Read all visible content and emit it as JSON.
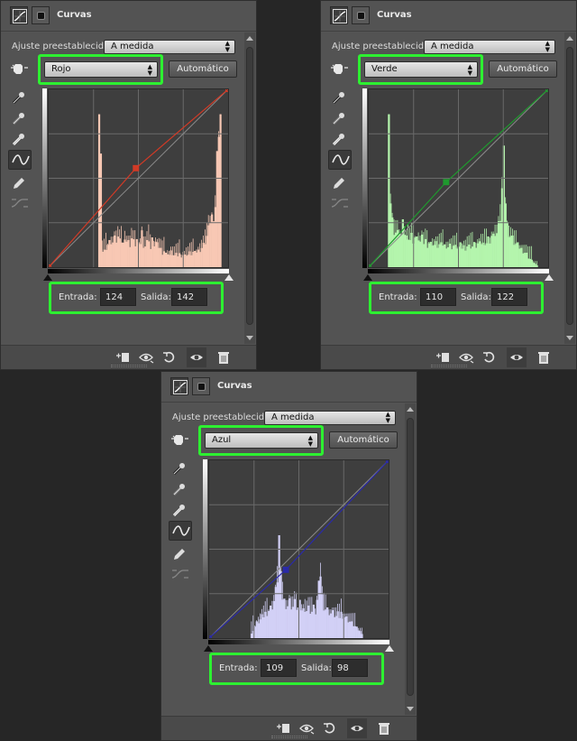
{
  "panels": [
    {
      "id": "red",
      "title": "Curvas",
      "preset_label": "Ajuste preestablecido:",
      "preset_value": "A medida",
      "channel": "Rojo",
      "auto_label": "Automático",
      "input_label": "Entrada:",
      "input_value": "124",
      "output_label": "Salida:",
      "output_value": "142",
      "curve_color": "#d23a26",
      "hist_color": "#f8c8b4",
      "histogram": [
        0,
        0,
        0,
        0,
        0,
        0,
        0,
        0,
        0,
        0,
        0,
        0,
        0,
        0,
        0,
        0,
        0,
        0,
        0,
        0,
        0,
        0,
        0,
        0,
        0,
        0,
        0,
        0,
        0,
        1.6,
        1.0,
        0.2,
        0.2,
        0.25,
        0.28,
        0.3,
        0.32,
        0.3,
        0.34,
        0.33,
        0.36,
        0.3,
        0.32,
        0.28,
        0.4,
        0.32,
        0.3,
        0.28,
        0.35,
        0.3,
        0.28,
        0.33,
        0.26,
        0.3,
        0.42,
        0.28,
        0.26,
        0.3,
        0.36,
        0.22,
        0.32,
        0.28,
        0.3,
        0.26,
        0.25,
        0.22,
        0.18,
        0.2,
        0.16,
        0.18,
        0.15,
        0.18,
        0.16,
        0.14,
        0.15,
        0.14,
        0.16,
        0.14,
        0.15,
        0.14,
        0.16,
        0.15,
        0.17,
        0.16,
        0.18,
        0.17,
        0.19,
        0.2,
        0.22,
        0.24,
        0.27,
        0.32,
        0.38,
        0.45,
        0.6,
        0.62,
        0.48,
        0.78,
        1.1,
        1.5,
        1.9,
        0,
        0,
        0,
        0
      ],
      "curve_points": [
        [
          0,
          0
        ],
        [
          124,
          142
        ],
        [
          255,
          255
        ]
      ]
    },
    {
      "id": "green",
      "title": "Curvas",
      "preset_label": "Ajuste preestablecido:",
      "preset_value": "A medida",
      "channel": "Verde",
      "auto_label": "Automático",
      "input_label": "Entrada:",
      "input_value": "110",
      "output_label": "Salida:",
      "output_value": "122",
      "curve_color": "#1f9a2e",
      "hist_color": "#b4f5ad",
      "histogram": [
        0,
        0,
        0,
        0,
        0,
        0,
        0,
        0,
        0,
        0,
        0,
        1.9,
        0.8,
        0.55,
        0.45,
        0.42,
        0.4,
        0.45,
        0.38,
        0.5,
        0.42,
        0.36,
        0.4,
        0.34,
        0.38,
        0.33,
        0.36,
        0.33,
        0.36,
        0.3,
        0.34,
        0.3,
        0.32,
        0.28,
        0.3,
        0.28,
        0.3,
        0.27,
        0.28,
        0.26,
        0.27,
        0.26,
        0.28,
        0.26,
        0.27,
        0.25,
        0.26,
        0.25,
        0.26,
        0.24,
        0.25,
        0.24,
        0.26,
        0.24,
        0.25,
        0.24,
        0.26,
        0.25,
        0.26,
        0.25,
        0.27,
        0.26,
        0.28,
        0.27,
        0.3,
        0.28,
        0.32,
        0.3,
        0.34,
        0.33,
        0.38,
        0.36,
        0.42,
        0.4,
        0.48,
        0.6,
        0.9,
        1.4,
        0.8,
        0.5,
        0.42,
        0.38,
        0.34,
        0.3,
        0.28,
        0.26,
        0.24,
        0.22,
        0.2,
        0.18,
        0.16,
        0.12,
        0.1,
        0.08,
        0.06,
        0.04,
        0.02,
        0,
        0,
        0,
        0,
        0,
        0
      ],
      "curve_points": [
        [
          0,
          0
        ],
        [
          110,
          122
        ],
        [
          255,
          255
        ]
      ]
    },
    {
      "id": "blue",
      "title": "Curvas",
      "preset_label": "Ajuste preestablecido:",
      "preset_value": "A medida",
      "channel": "Azul",
      "auto_label": "Automático",
      "input_label": "Entrada:",
      "input_value": "109",
      "output_label": "Salida:",
      "output_value": "98",
      "curve_color": "#2a2aa8",
      "hist_color": "#d2d0f6",
      "histogram": [
        0,
        0,
        0,
        0,
        0,
        0,
        0,
        0,
        0,
        0,
        0,
        0,
        0,
        0,
        0,
        0,
        0,
        0,
        0,
        0,
        0,
        0,
        0,
        0,
        0.05,
        0.1,
        0.14,
        0.18,
        0.2,
        0.22,
        0.25,
        0.27,
        0.3,
        0.32,
        0.34,
        0.36,
        0.4,
        0.45,
        0.55,
        0.75,
        1.0,
        0.7,
        0.5,
        0.45,
        0.42,
        0.4,
        0.44,
        0.4,
        0.38,
        0.42,
        0.38,
        0.36,
        0.4,
        0.36,
        0.34,
        0.38,
        0.34,
        0.36,
        0.34,
        0.32,
        0.36,
        0.32,
        0.45,
        0.6,
        0.8,
        0.5,
        0.4,
        0.36,
        0.34,
        0.32,
        0.3,
        0.3,
        0.28,
        0.26,
        0.28,
        0.26,
        0.3,
        0.28,
        0.26,
        0.24,
        0.22,
        0.2,
        0.18,
        0.16,
        0.14,
        0.12,
        0.1,
        0.08,
        0.06,
        0,
        0,
        0,
        0,
        0,
        0,
        0,
        0,
        0,
        0,
        0,
        0,
        0,
        0,
        0
      ],
      "curve_points": [
        [
          0,
          0
        ],
        [
          109,
          98
        ],
        [
          255,
          255
        ]
      ]
    }
  ]
}
